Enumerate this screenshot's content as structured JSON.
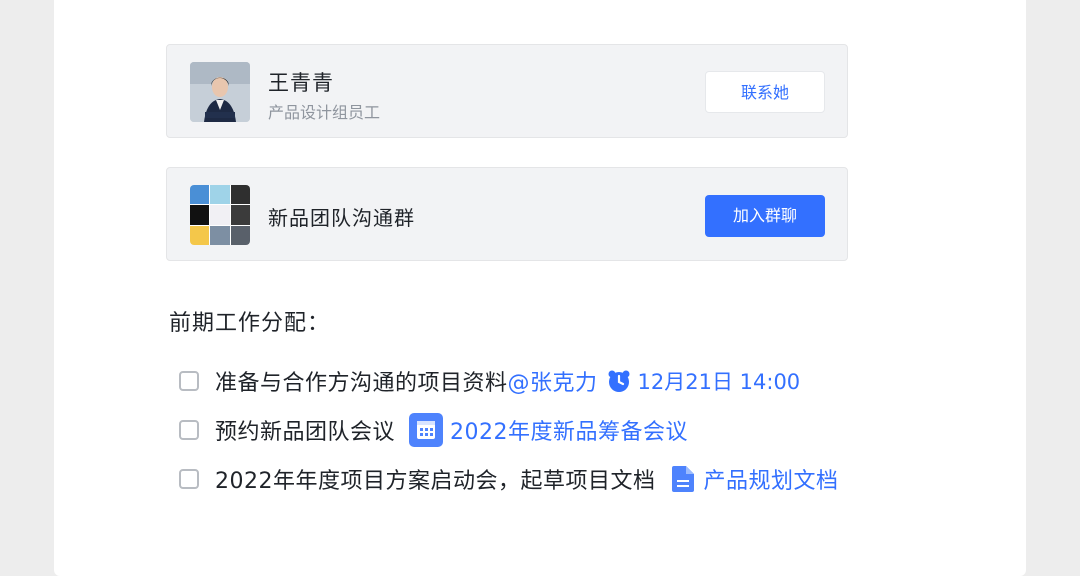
{
  "contact_card": {
    "name": "王青青",
    "title": "产品设计组员工",
    "button_label": "联系她"
  },
  "group_card": {
    "name": "新品团队沟通群",
    "button_label": "加入群聊"
  },
  "section_title": "前期工作分配：",
  "tasks": [
    {
      "text": "准备与合作方沟通的项目资料",
      "mention": "@张克力",
      "due_icon": "alarm-clock-icon",
      "due": "12月21日 14:00",
      "checked": false
    },
    {
      "text": "预约新品团队会议",
      "link_icon": "calendar-icon",
      "link": "2022年度新品筹备会议",
      "checked": false
    },
    {
      "text": "2022年年度项目方案启动会，起草项目文档",
      "link_icon": "document-icon",
      "link": "产品规划文档",
      "checked": false
    }
  ],
  "colors": {
    "accent": "#3370ff",
    "card_background": "#f2f3f5",
    "text_primary": "#1f2329",
    "text_secondary": "#8f959e"
  }
}
